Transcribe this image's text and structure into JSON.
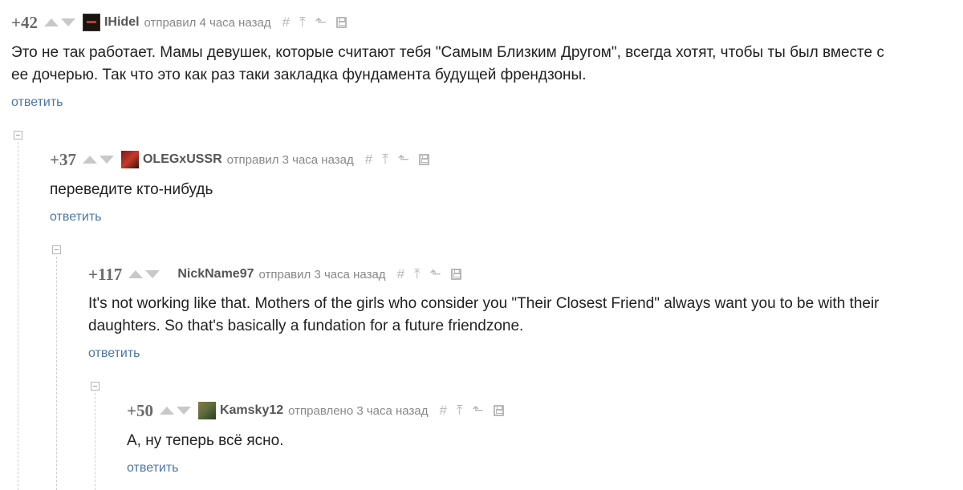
{
  "comments": [
    {
      "rating": "+42",
      "nick": "IHidel",
      "sent": "отправил 4 часа назад",
      "body": "Это не так работает. Мамы девушек, которые считают тебя \"Самым Близким Другом\", всегда хотят, чтобы ты был вместе с ее дочерью. Так что это как раз таки закладка фундамента будущей френдзоны.",
      "reply": "ответить"
    },
    {
      "rating": "+37",
      "nick": "OLEGxUSSR",
      "sent": "отправил 3 часа назад",
      "body": "переведите кто-нибудь",
      "reply": "ответить"
    },
    {
      "rating": "+117",
      "nick": "NickName97",
      "sent": "отправил 3 часа назад",
      "body": "It's not working like that. Mothers of the girls who consider you \"Their Closest Friend\" always want you to be with their daughters. So that's basically a fundation for a future friendzone.",
      "reply": "ответить"
    },
    {
      "rating": "+50",
      "nick": "Kamsky12",
      "sent": "отправлено 3 часа назад",
      "body": "А, ну теперь всё ясно.",
      "reply": "ответить"
    }
  ],
  "tool_icons": [
    "hash-icon",
    "arrow-up-icon",
    "branch-icon",
    "save-icon"
  ],
  "colors": {
    "reply_link": "#4a76a8",
    "rating": "#6a6a6a",
    "icon": "#b8b8b8"
  }
}
